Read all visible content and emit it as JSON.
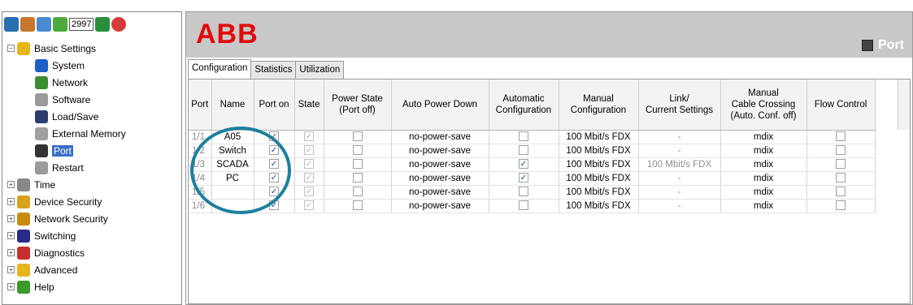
{
  "toolbar": {
    "counter": "2997",
    "icons": [
      "home-icon",
      "users-icon",
      "search-icon",
      "flag-icon",
      "save-icon",
      "close-icon"
    ]
  },
  "tree": {
    "basic_settings": "Basic Settings",
    "basic_children": [
      {
        "label": "System",
        "icon": "info-icon",
        "color": "#1b5fc7"
      },
      {
        "label": "Network",
        "icon": "network-icon",
        "color": "#3a8d33"
      },
      {
        "label": "Software",
        "icon": "software-icon",
        "color": "#9a9a9a"
      },
      {
        "label": "Load/Save",
        "icon": "floppy-icon",
        "color": "#2c3e70"
      },
      {
        "label": "External Memory",
        "icon": "memory-icon",
        "color": "#a0a0a0"
      },
      {
        "label": "Port",
        "icon": "port-icon",
        "color": "#333333",
        "selected": true
      },
      {
        "label": "Restart",
        "icon": "restart-icon",
        "color": "#9a9a9a"
      }
    ],
    "top_items": [
      {
        "label": "Time",
        "icon": "clock-icon",
        "color": "#888888"
      },
      {
        "label": "Device Security",
        "icon": "lock-icon",
        "color": "#d9a21b"
      },
      {
        "label": "Network Security",
        "icon": "shield-icon",
        "color": "#c98a10"
      },
      {
        "label": "Switching",
        "icon": "switching-icon",
        "color": "#2a2a8a"
      },
      {
        "label": "Diagnostics",
        "icon": "diagnostics-icon",
        "color": "#c7302a"
      },
      {
        "label": "Advanced",
        "icon": "star-icon",
        "color": "#e8b61a"
      },
      {
        "label": "Help",
        "icon": "help-icon",
        "color": "#3a9a2c"
      }
    ]
  },
  "header": {
    "logo": "ABB",
    "title": "Port"
  },
  "tabs": [
    "Configuration",
    "Statistics",
    "Utilization"
  ],
  "table": {
    "headers": {
      "port": "Port",
      "name": "Name",
      "port_on": "Port on",
      "state": "State",
      "power_state_1": "Power State",
      "power_state_2": "(Port off)",
      "auto_power_down": "Auto Power Down",
      "auto_config_1": "Automatic",
      "auto_config_2": "Configuration",
      "manual_config_1": "Manual",
      "manual_config_2": "Configuration",
      "link_1": "Link/",
      "link_2": "Current Settings",
      "cable_1": "Manual",
      "cable_2": "Cable Crossing",
      "cable_3": "(Auto. Conf. off)",
      "flow_control": "Flow Control"
    },
    "rows": [
      {
        "port": "1/1",
        "name": "A05",
        "port_on": true,
        "state": true,
        "power_state": false,
        "auto_power_down": "no-power-save",
        "auto_config": false,
        "manual_config": "100 Mbit/s FDX",
        "link": "-",
        "cable": "mdix",
        "flow": false
      },
      {
        "port": "1/2",
        "name": "Switch",
        "port_on": true,
        "state": true,
        "power_state": false,
        "auto_power_down": "no-power-save",
        "auto_config": false,
        "manual_config": "100 Mbit/s FDX",
        "link": "-",
        "cable": "mdix",
        "flow": false
      },
      {
        "port": "1/3",
        "name": "SCADA",
        "port_on": true,
        "state": true,
        "power_state": false,
        "auto_power_down": "no-power-save",
        "auto_config": true,
        "manual_config": "100 Mbit/s FDX",
        "link": "100 Mbit/s FDX",
        "cable": "mdix",
        "flow": false
      },
      {
        "port": "1/4",
        "name": "PC",
        "port_on": true,
        "state": true,
        "power_state": false,
        "auto_power_down": "no-power-save",
        "auto_config": true,
        "manual_config": "100 Mbit/s FDX",
        "link": "-",
        "cable": "mdix",
        "flow": false
      },
      {
        "port": "1/5",
        "name": "",
        "port_on": true,
        "state": true,
        "power_state": false,
        "auto_power_down": "no-power-save",
        "auto_config": false,
        "manual_config": "100 Mbit/s FDX",
        "link": "-",
        "cable": "mdix",
        "flow": false
      },
      {
        "port": "1/6",
        "name": "",
        "port_on": true,
        "state": true,
        "power_state": false,
        "auto_power_down": "no-power-save",
        "auto_config": false,
        "manual_config": "100 Mbit/s FDX",
        "link": "-",
        "cable": "mdix",
        "flow": false
      }
    ]
  },
  "colors": {
    "logo": "#e10a0a",
    "header_bg": "#c9c9c9",
    "highlight_circle": "#1e7fa0",
    "selection": "#3a6fc4"
  }
}
